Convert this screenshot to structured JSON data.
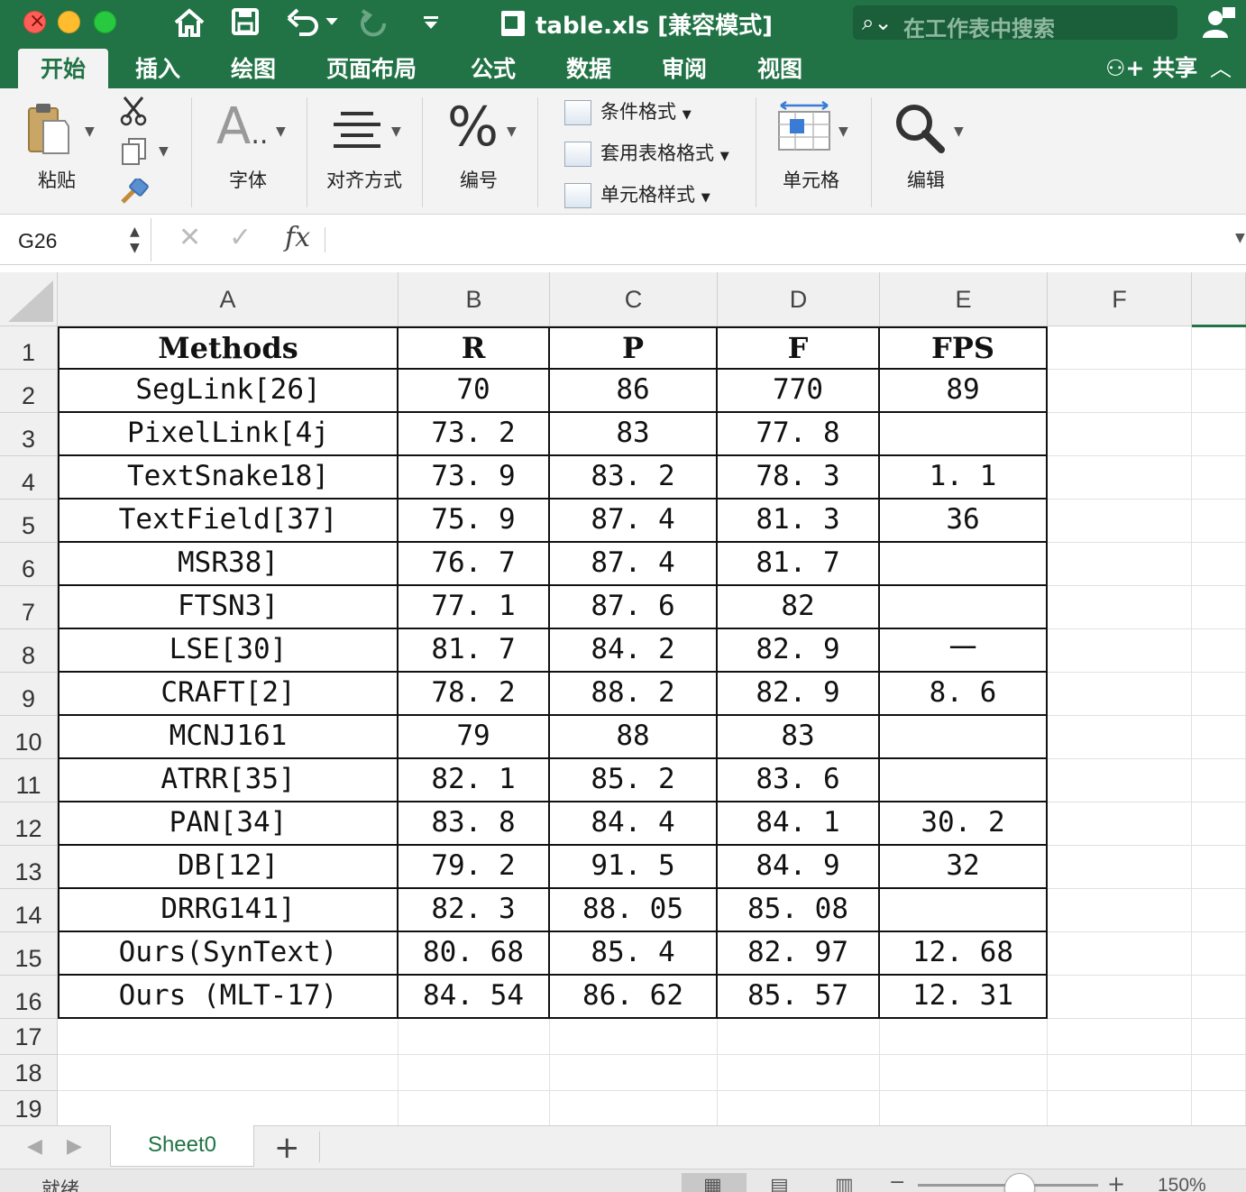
{
  "window": {
    "title": "table.xls  [兼容模式]",
    "search_placeholder": "在工作表中搜索"
  },
  "ribbon_tabs": [
    "开始",
    "插入",
    "绘图",
    "页面布局",
    "公式",
    "数据",
    "审阅",
    "视图"
  ],
  "share_label": "共享",
  "ribbon": {
    "paste": "粘贴",
    "font": "字体",
    "alignment": "对齐方式",
    "number": "编号",
    "conditional_format": "条件格式",
    "table_format": "套用表格格式",
    "cell_styles": "单元格样式",
    "cells": "单元格",
    "editing": "编辑"
  },
  "formula_bar": {
    "name_box": "G26",
    "fx": "fx",
    "formula": ""
  },
  "columns": [
    "A",
    "B",
    "C",
    "D",
    "E",
    "F"
  ],
  "row_numbers": [
    "1",
    "2",
    "3",
    "4",
    "5",
    "6",
    "7",
    "8",
    "9",
    "10",
    "11",
    "12",
    "13",
    "14",
    "15",
    "16",
    "17",
    "18",
    "19"
  ],
  "table": {
    "headers": [
      "Methods",
      "R",
      "P",
      "F",
      "FPS"
    ],
    "rows": [
      [
        "SegLink[26]",
        "70",
        "86",
        "770",
        "89"
      ],
      [
        "PixelLink[4j",
        "73. 2",
        "83",
        "77. 8",
        ""
      ],
      [
        "TextSnake18]",
        "73. 9",
        "83. 2",
        "78. 3",
        "1. 1"
      ],
      [
        "TextField[37]",
        "75. 9",
        "87. 4",
        "81. 3",
        "36"
      ],
      [
        "MSR38]",
        "76. 7",
        "87. 4",
        "81. 7",
        ""
      ],
      [
        "FTSN3]",
        "77. 1",
        "87. 6",
        "82",
        ""
      ],
      [
        "LSE[30]",
        "81. 7",
        "84. 2",
        "82. 9",
        "一"
      ],
      [
        "CRAFT[2]",
        "78. 2",
        "88. 2",
        "82. 9",
        "8. 6"
      ],
      [
        "MCNJ161",
        "79",
        "88",
        "83",
        ""
      ],
      [
        "ATRR[35]",
        "82. 1",
        "85. 2",
        "83. 6",
        ""
      ],
      [
        "PAN[34]",
        "83. 8",
        "84. 4",
        "84. 1",
        "30. 2"
      ],
      [
        "DB[12]",
        "79. 2",
        "91. 5",
        "84. 9",
        "32"
      ],
      [
        "DRRG141]",
        "82. 3",
        "88. 05",
        "85. 08",
        ""
      ],
      [
        "Ours(SynText)",
        "80. 68",
        "85. 4",
        "82. 97",
        "12. 68"
      ],
      [
        "Ours  (MLT-17)",
        "84. 54",
        "86. 62",
        "85. 57",
        "12. 31"
      ]
    ]
  },
  "sheet_tab": "Sheet0",
  "status": {
    "text": "就绪",
    "zoom": "150%"
  },
  "colors": {
    "excel_green": "#217346",
    "ribbon_bg": "#f3f3f3"
  }
}
